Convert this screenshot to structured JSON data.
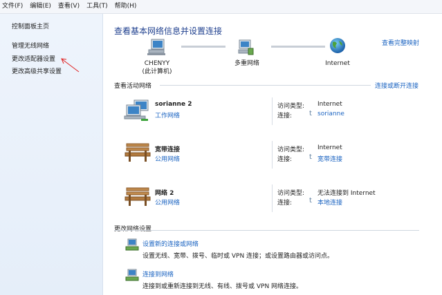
{
  "menu": [
    {
      "label": "文件(F)"
    },
    {
      "label": "编辑(E)"
    },
    {
      "label": "查看(V)"
    },
    {
      "label": "工具(T)"
    },
    {
      "label": "帮助(H)"
    }
  ],
  "sidebar": {
    "items": [
      {
        "label": "控制面板主页"
      },
      {
        "label": "管理无线网络"
      },
      {
        "label": "更改适配器设置"
      },
      {
        "label": "更改高级共享设置"
      }
    ]
  },
  "main": {
    "title": "查看基本网络信息并设置连接",
    "view_full_map": "查看完整映射",
    "map": {
      "computer_name": "CHENYY",
      "computer_sub": "(此计算机)",
      "middle_label": "多重网络",
      "internet_label": "Internet"
    },
    "active_section": {
      "title": "查看活动网络",
      "connect_link": "连接或断开连接"
    },
    "access_type_label": "访问类型:",
    "connection_label": "连接:",
    "networks": [
      {
        "name": "sorianne  2",
        "type": "工作网络",
        "access": "Internet",
        "connection": "sorianne"
      },
      {
        "name": "宽带连接",
        "type": "公用网络",
        "access": "Internet",
        "connection": "宽带连接"
      },
      {
        "name": "网络  2",
        "type": "公用网络",
        "access": "无法连接到 Internet",
        "connection": "本地连接"
      }
    ],
    "change_section": {
      "title": "更改网络设置",
      "tasks": [
        {
          "link": "设置新的连接或网络",
          "desc": "设置无线、宽带、拨号、临时或 VPN 连接；或设置路由器或访问点。"
        },
        {
          "link": "连接到网络",
          "desc": "连接到或重新连接到无线、有线、拨号或 VPN 网络连接。"
        }
      ]
    }
  },
  "colors": {
    "accent_link": "#1a63c1",
    "title_blue": "#1e3f8e",
    "annotation_arrow": "#e02020"
  }
}
